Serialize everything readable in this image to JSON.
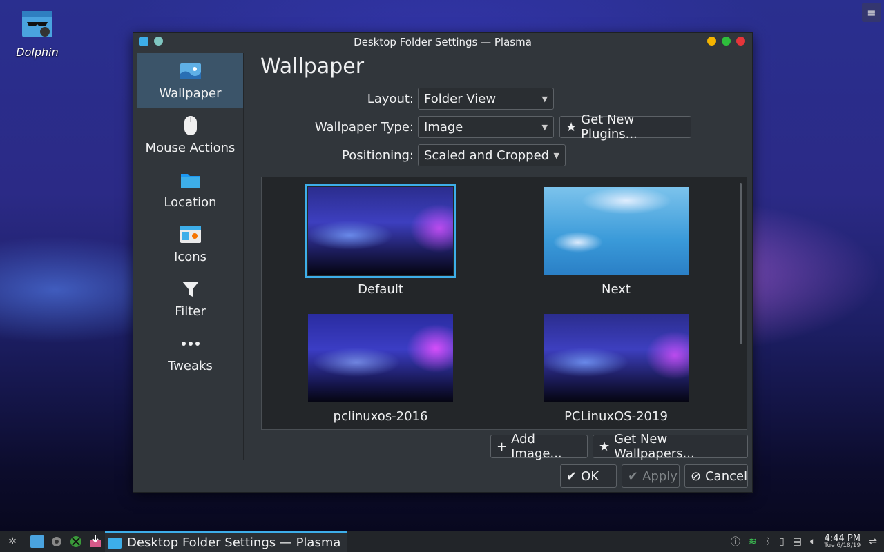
{
  "desktop": {
    "icon_label": "Dolphin"
  },
  "window": {
    "title": "Desktop Folder Settings — Plasma"
  },
  "sidebar": {
    "items": [
      {
        "label": "Wallpaper",
        "icon": "wallpaper-icon",
        "active": true
      },
      {
        "label": "Mouse Actions",
        "icon": "mouse-icon"
      },
      {
        "label": "Location",
        "icon": "folder-icon"
      },
      {
        "label": "Icons",
        "icon": "icons-icon"
      },
      {
        "label": "Filter",
        "icon": "filter-icon"
      },
      {
        "label": "Tweaks",
        "icon": "more-icon"
      }
    ]
  },
  "main": {
    "heading": "Wallpaper",
    "layout": {
      "label": "Layout:",
      "value": "Folder View"
    },
    "wallpaper_type": {
      "label": "Wallpaper Type:",
      "value": "Image"
    },
    "positioning": {
      "label": "Positioning:",
      "value": "Scaled and Cropped"
    },
    "get_new_plugins": "Get New Plugins...",
    "wallpapers": [
      {
        "name": "Default",
        "selected": true
      },
      {
        "name": "Next"
      },
      {
        "name": "pclinuxos-2016"
      },
      {
        "name": "PCLinuxOS-2019"
      }
    ],
    "add_image": "Add Image...",
    "get_new_wallpapers": "Get New Wallpapers..."
  },
  "dialog_buttons": {
    "ok": "OK",
    "apply": "Apply",
    "cancel": "Cancel"
  },
  "taskbar": {
    "task_label": "Desktop Folder Settings — Plasma",
    "time": "4:44 PM",
    "date": "Tue 6/18/19"
  },
  "colors": {
    "accent": "#3daee9",
    "window_bg": "#31363b",
    "selected_bg": "#3b5469"
  }
}
